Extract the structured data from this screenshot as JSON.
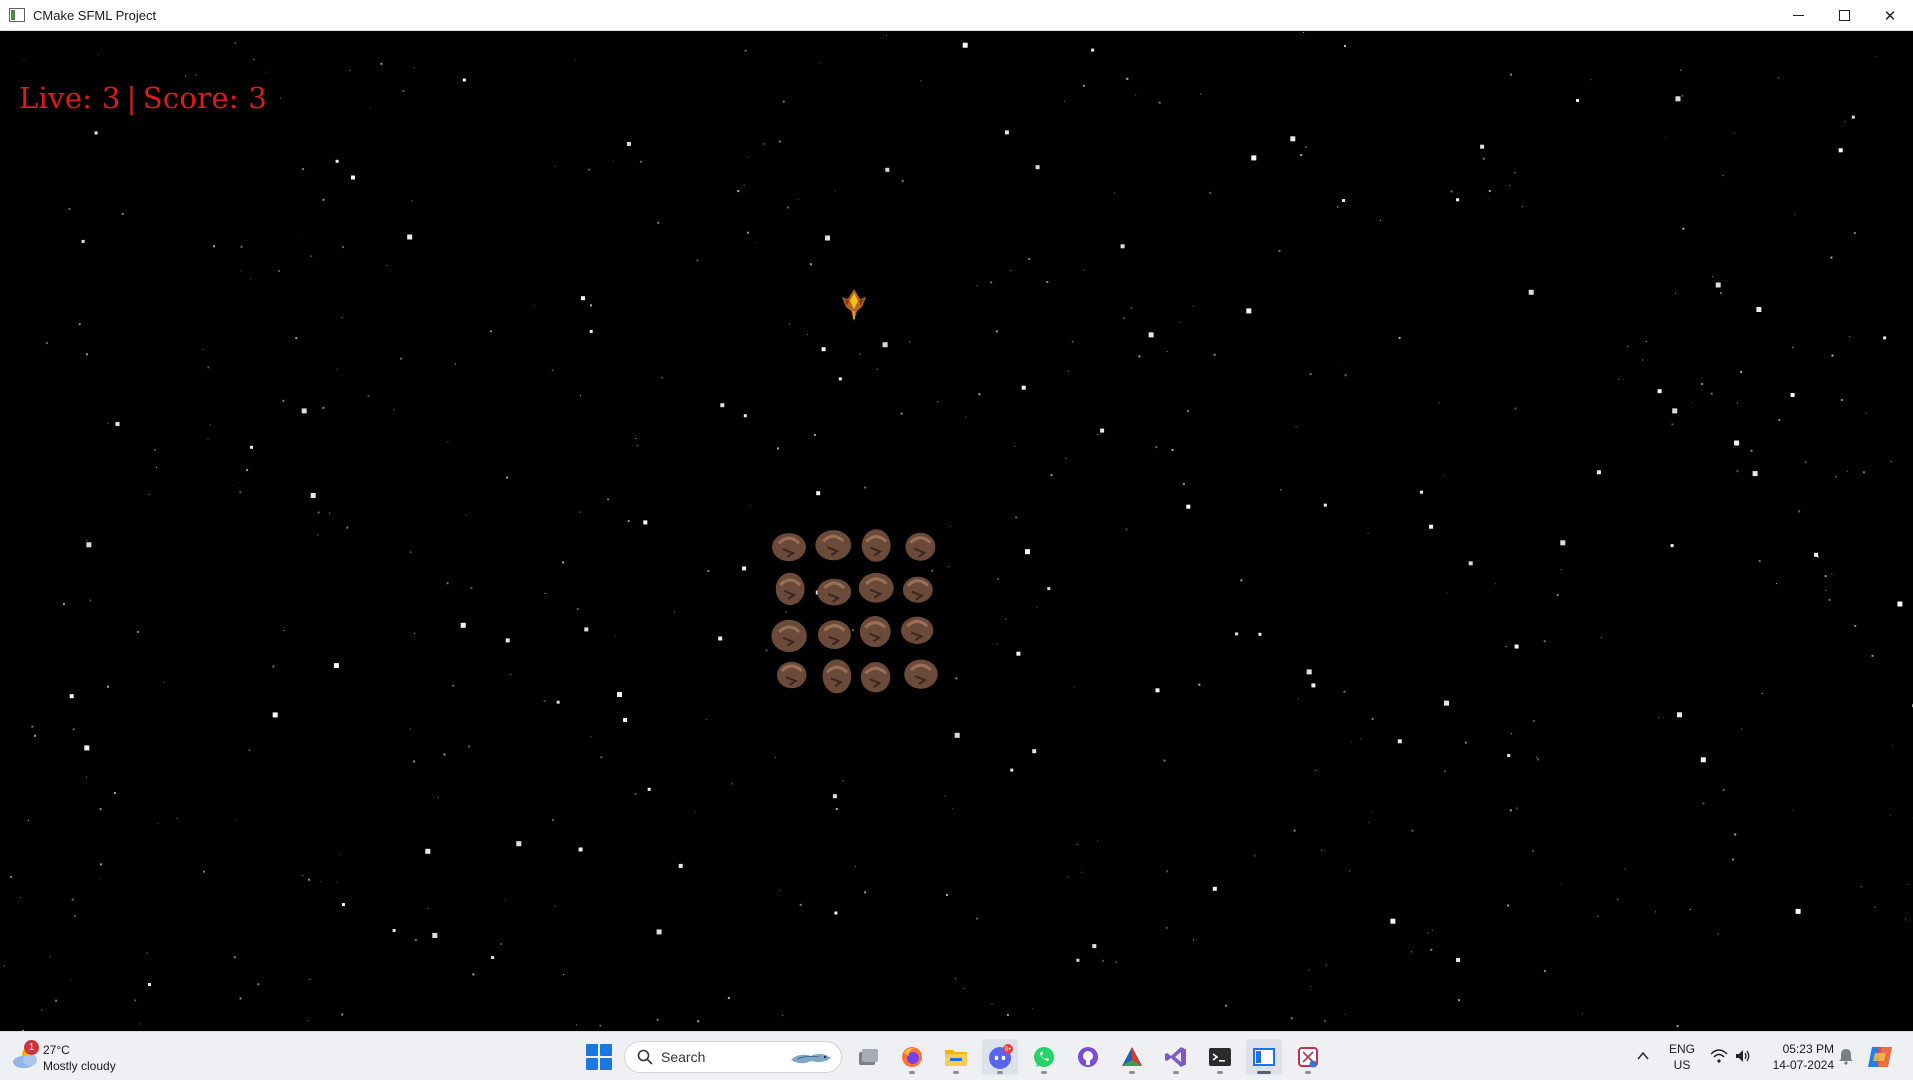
{
  "window": {
    "title": "CMake SFML Project",
    "controls": [
      "minimize-icon",
      "maximize-icon",
      "close-icon"
    ]
  },
  "game": {
    "hud": {
      "lives_label": "Live: 3",
      "separator": "|",
      "score_label": "Score: 3"
    },
    "colors": {
      "background": "#000000",
      "hud_text": "#e01a1a",
      "star": "#ffffff",
      "asteroid": "#6b4a3a",
      "asteroid_highlight": "#9a7058"
    },
    "sprites": [
      "player-ship",
      "asteroid-cluster",
      "star-field"
    ]
  },
  "taskbar": {
    "weather": {
      "badge": "1",
      "temperature": "27°C",
      "condition": "Mostly cloudy"
    },
    "search": {
      "label": "Search"
    },
    "apps": [
      {
        "name": "task-view-icon"
      },
      {
        "name": "firefox-icon"
      },
      {
        "name": "file-explorer-icon"
      },
      {
        "name": "discord-icon",
        "badge": "9+"
      },
      {
        "name": "whatsapp-icon"
      },
      {
        "name": "github-desktop-icon"
      },
      {
        "name": "cmake-icon"
      },
      {
        "name": "visual-studio-icon"
      },
      {
        "name": "terminal-icon"
      },
      {
        "name": "sfml-window-icon"
      },
      {
        "name": "snipping-tool-icon"
      }
    ],
    "tray": {
      "lang_line1": "ENG",
      "lang_line2": "US",
      "time": "05:23 PM",
      "date": "14-07-2024"
    }
  }
}
